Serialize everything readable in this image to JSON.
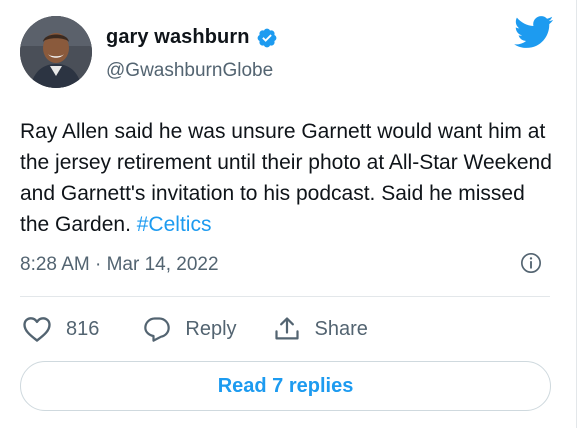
{
  "tweet": {
    "author": {
      "display_name": "gary washburn",
      "handle": "@GwashburnGlobe",
      "verified": true
    },
    "text": "Ray Allen said he was unsure Garnett would want him at the jersey retirement until their photo at All-Star Weekend and Garnett's invitation to his podcast. Said he missed the Garden.",
    "hashtag": "#Celtics",
    "timestamp": "8:28 AM · Mar 14, 2022"
  },
  "actions": {
    "like_count": "816",
    "reply_label": "Reply",
    "share_label": "Share"
  },
  "read_replies_label": "Read 7 replies",
  "colors": {
    "accent": "#1d9bf0",
    "text_primary": "#0f1419",
    "text_secondary": "#536471",
    "border": "#cfd9de"
  },
  "icons": [
    "twitter-bird-icon",
    "verified-badge-icon",
    "info-icon",
    "heart-icon",
    "reply-bubble-icon",
    "share-icon"
  ]
}
